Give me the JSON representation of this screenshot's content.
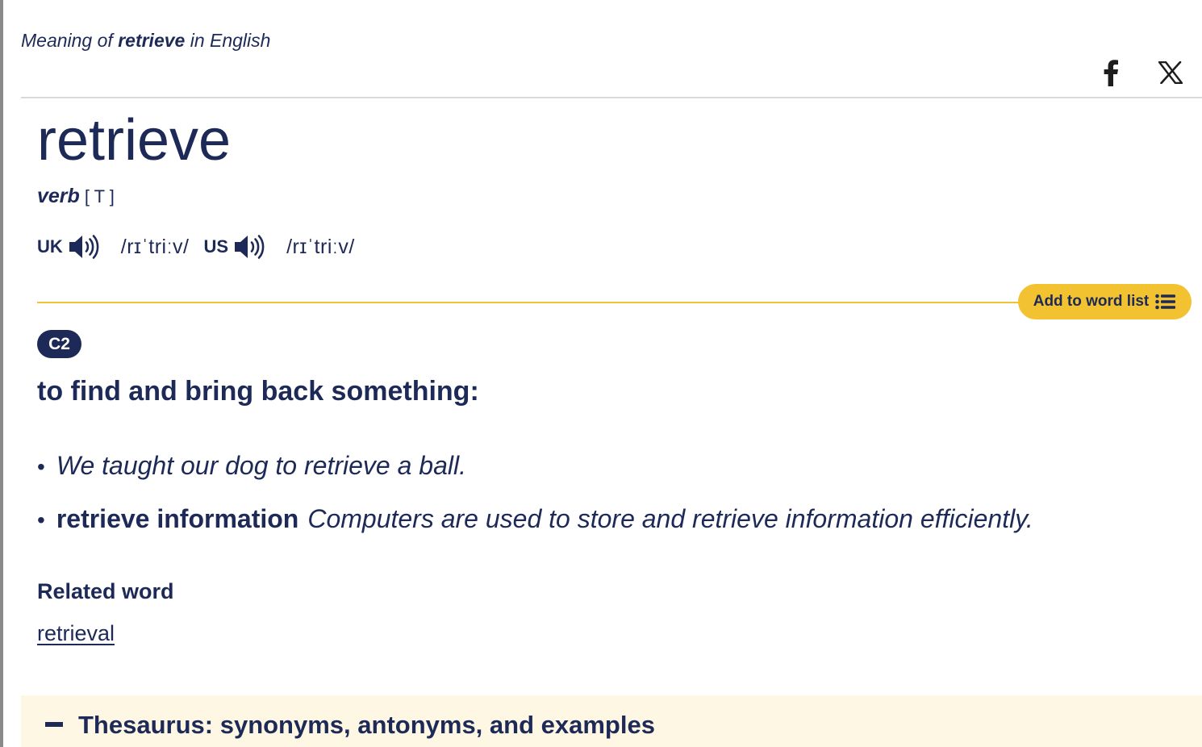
{
  "header": {
    "meaning_prefix": "Meaning of",
    "meaning_word": "retrieve",
    "meaning_suffix": "in English"
  },
  "share": {
    "icons": [
      "facebook-icon",
      "x-icon"
    ]
  },
  "entry": {
    "headword": "retrieve",
    "pos": "verb",
    "grammar": "[ T ]",
    "pronunciations": [
      {
        "region": "UK",
        "ipa": "/rɪˈtriːv/",
        "icon": "speaker-icon"
      },
      {
        "region": "US",
        "ipa": "/rɪˈtriːv/",
        "icon": "speaker-icon"
      }
    ]
  },
  "word_list_button": {
    "label": "Add to word list",
    "icon": "list-icon"
  },
  "sense": {
    "level": "C2",
    "definition": "to find and bring back something:",
    "examples": [
      {
        "collocation": "",
        "text": "We taught our dog to retrieve a ball."
      },
      {
        "collocation": "retrieve information",
        "text": "Computers are used to store and retrieve information efficiently."
      }
    ],
    "related_label": "Related word",
    "related_word": "retrieval"
  },
  "thesaurus": {
    "title": "Thesaurus: synonyms, antonyms, and examples",
    "icon": "minus-icon"
  },
  "colors": {
    "text": "#1d2a57",
    "accent": "#f2c230",
    "thesaurus_bg": "#fef7e3"
  }
}
